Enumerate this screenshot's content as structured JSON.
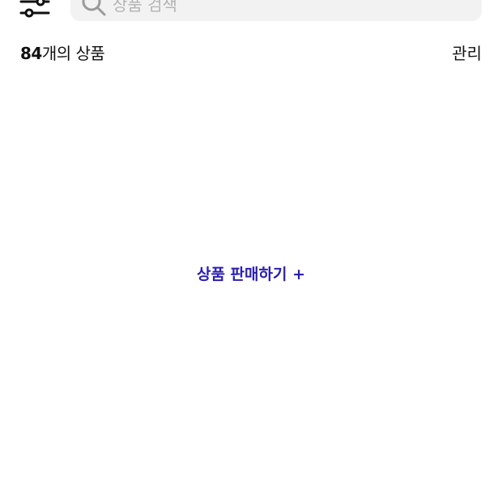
{
  "search": {
    "placeholder": "상품 검색"
  },
  "list_header": {
    "count": "84",
    "count_suffix": "개의 상품",
    "manage_label": "관리"
  },
  "empty_state": {
    "sell_link_label": "상품 판매하기 +"
  },
  "colors": {
    "accent": "#2a1fb0",
    "text": "#111111",
    "search_bg": "#f2f2f2",
    "placeholder": "#b3b3b3"
  },
  "icons": {
    "filter": "sliders-icon",
    "search": "magnifier-icon"
  }
}
